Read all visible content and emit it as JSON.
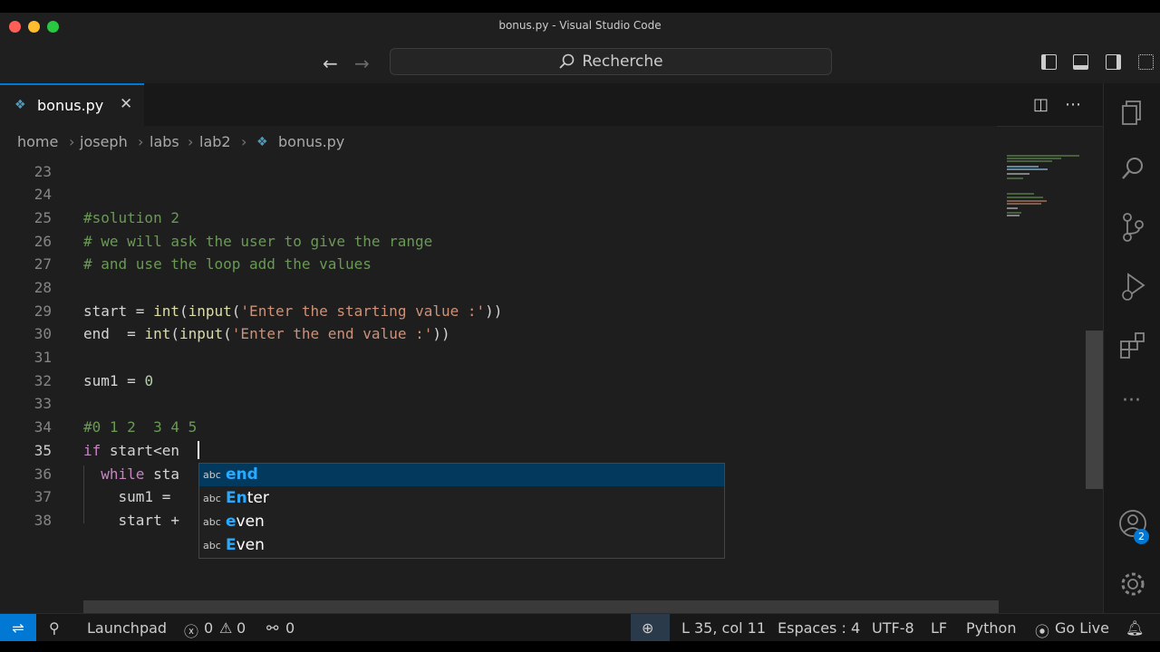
{
  "window": {
    "title": "bonus.py - Visual Studio Code"
  },
  "titlebar": {
    "search_label": "Recherche"
  },
  "tab": {
    "label": "bonus.py",
    "close": "✕"
  },
  "breadcrumb": {
    "parts": [
      "home",
      "joseph",
      "labs",
      "lab2",
      "bonus.py"
    ]
  },
  "editor": {
    "lines": [
      {
        "num": "23",
        "text": ""
      },
      {
        "num": "24",
        "text": ""
      },
      {
        "num": "25",
        "text": "#solution 2"
      },
      {
        "num": "26",
        "text": "# we will ask the user to give the range"
      },
      {
        "num": "27",
        "text": "# and use the loop add the values"
      },
      {
        "num": "28",
        "text": ""
      },
      {
        "num": "29",
        "text": "start = int(input('Enter the starting value :'))"
      },
      {
        "num": "30",
        "text": "end  = int(input('Enter the end value :'))"
      },
      {
        "num": "31",
        "text": ""
      },
      {
        "num": "32",
        "text": "sum1 = 0"
      },
      {
        "num": "33",
        "text": ""
      },
      {
        "num": "34",
        "text": "#0 1 2  3 4 5"
      },
      {
        "num": "35",
        "text": "if start<en"
      },
      {
        "num": "36",
        "text": "  while sta"
      },
      {
        "num": "37",
        "text": "    sum1 ="
      },
      {
        "num": "38",
        "text": "    start +"
      }
    ],
    "suggestions": [
      {
        "kind": "abc",
        "match": "en",
        "rest": "d",
        "selected": true
      },
      {
        "kind": "abc",
        "match": "En",
        "rest": "ter",
        "selected": false
      },
      {
        "kind": "abc",
        "match": "e",
        "rest": "ven",
        "selected": false
      },
      {
        "kind": "abc",
        "match": "E",
        "rest": "ven",
        "selected": false
      }
    ]
  },
  "activity": {
    "accounts_badge": "2"
  },
  "statusbar": {
    "launchpad": "Launchpad",
    "errors": "0",
    "warnings": "0",
    "ports": "0",
    "position": "L 35, col 11",
    "indent": "Espaces : 4",
    "encoding": "UTF-8",
    "eol": "LF",
    "language": "Python",
    "golive": "Go Live"
  },
  "colors": {
    "accent": "#0078d4",
    "selection": "#04395e",
    "match": "#2aaaff"
  }
}
